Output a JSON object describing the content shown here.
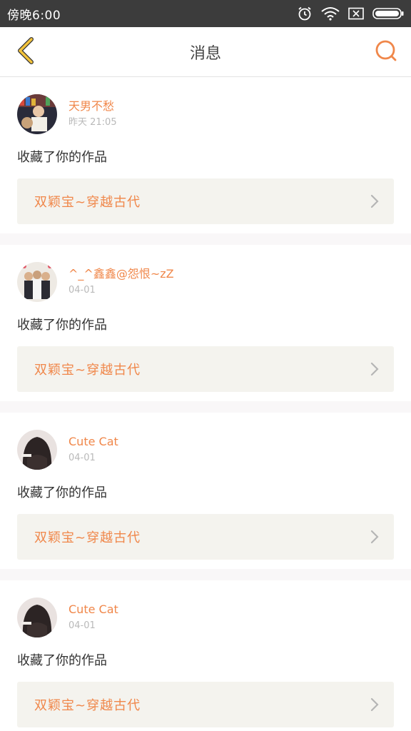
{
  "status_bar": {
    "time": "傍晚6:00",
    "icons": [
      "alarm-icon",
      "wifi-icon",
      "no-sim-icon",
      "battery-icon"
    ]
  },
  "nav": {
    "title": "消息",
    "back_icon": "chevron-left-icon",
    "search_icon": "search-icon"
  },
  "colors": {
    "accent": "#f0874a",
    "back_chevron": "#f3c33b",
    "status_bar": "#3c3c3c",
    "link_bg": "#f4f3ee"
  },
  "messages": [
    {
      "user": "天男不愁",
      "time": "昨天 21:05",
      "action": "收藏了你的作品",
      "work_title": "双颖宝~穿越古代"
    },
    {
      "user": "^_^鑫鑫@怨恨~zZ",
      "time": "04-01",
      "action": "收藏了你的作品",
      "work_title": "双颖宝~穿越古代"
    },
    {
      "user": "Cute Cat",
      "time": "04-01",
      "action": "收藏了你的作品",
      "work_title": "双颖宝~穿越古代"
    },
    {
      "user": "Cute Cat",
      "time": "04-01",
      "action": "收藏了你的作品",
      "work_title": "双颖宝~穿越古代"
    }
  ]
}
